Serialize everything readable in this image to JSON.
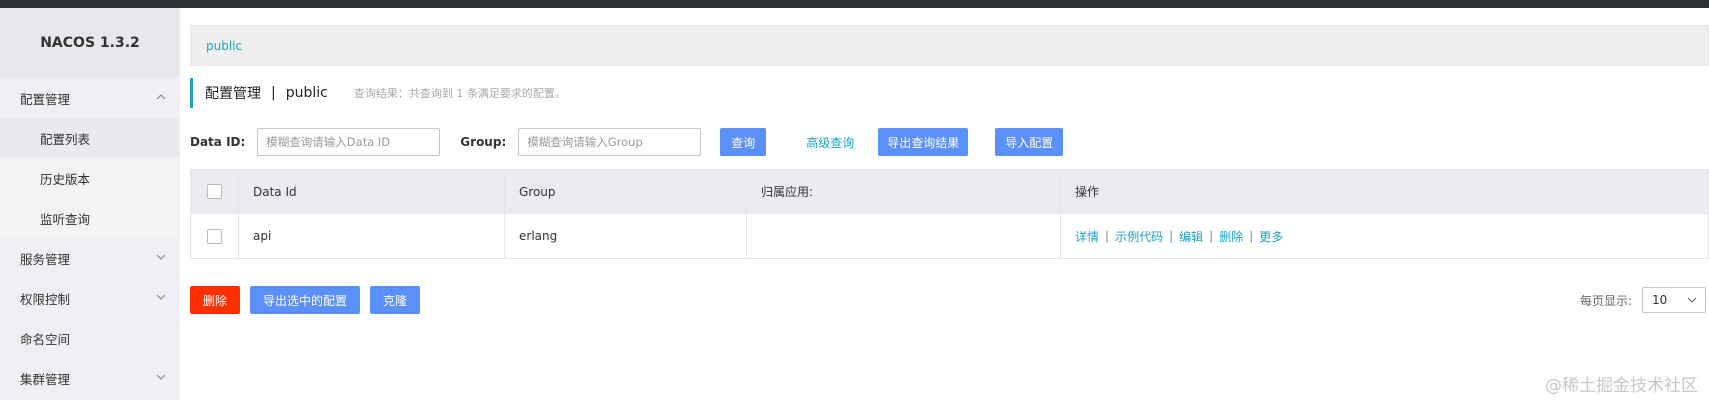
{
  "sidebar": {
    "brand": "NACOS 1.3.2",
    "items": [
      {
        "label": "配置管理",
        "icon": "chevron-up-icon"
      },
      {
        "label": "配置列表"
      },
      {
        "label": "历史版本"
      },
      {
        "label": "监听查询"
      },
      {
        "label": "服务管理",
        "icon": "chevron-down-icon"
      },
      {
        "label": "权限控制",
        "icon": "chevron-down-icon"
      },
      {
        "label": "命名空间"
      },
      {
        "label": "集群管理",
        "icon": "chevron-down-icon"
      }
    ]
  },
  "namespace_tab": "public",
  "title": {
    "main": "配置管理",
    "sep": "|",
    "namespace": "public",
    "hint": "查询结果：共查询到 1 条满足要求的配置。"
  },
  "search": {
    "dataid_label": "Data ID:",
    "dataid_placeholder": "模糊查询请输入Data ID",
    "group_label": "Group:",
    "group_placeholder": "模糊查询请输入Group",
    "query_button": "查询",
    "advanced": "高级查询",
    "export_results": "导出查询结果",
    "import_config": "导入配置"
  },
  "table": {
    "headers": [
      "Data Id",
      "Group",
      "归属应用:",
      "操作"
    ],
    "rows": [
      {
        "data_id": "api",
        "group": "erlang",
        "app": ""
      }
    ],
    "actions": [
      "详情",
      "示例代码",
      "编辑",
      "删除",
      "更多"
    ],
    "action_sep": "|"
  },
  "bottom": {
    "delete": "删除",
    "export_selected": "导出选中的配置",
    "clone": "克隆"
  },
  "pager": {
    "label": "每页显示:",
    "value": "10"
  },
  "watermark": "@稀土掘金技术社区",
  "colors": {
    "accent": "#1ba4c8",
    "primary_button": "#5b8ff9",
    "danger_button": "#ff3000"
  }
}
